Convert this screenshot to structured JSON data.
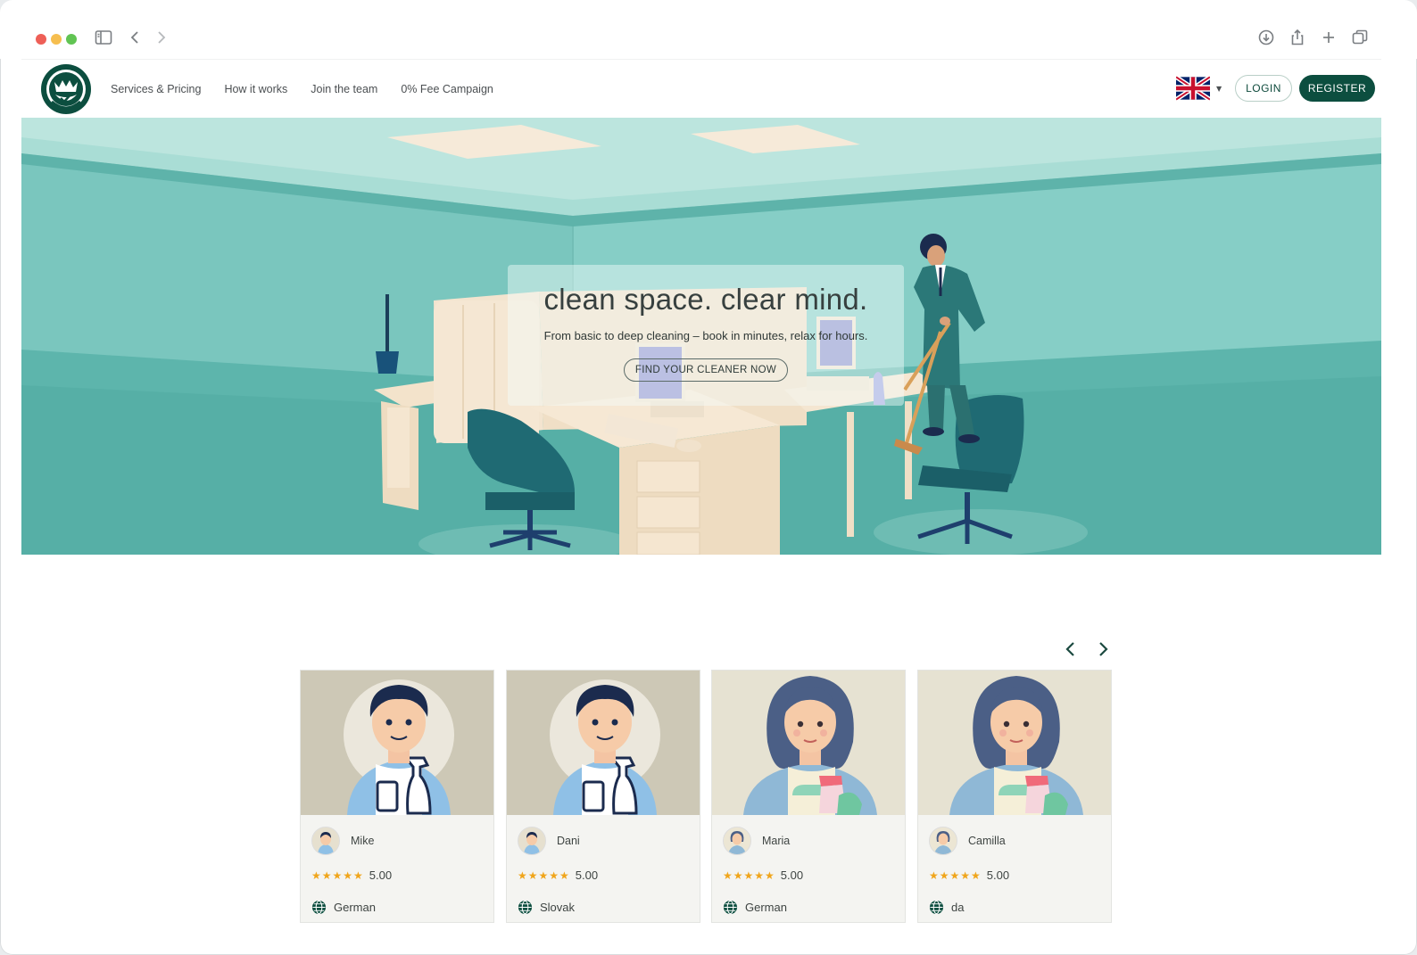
{
  "browser": {
    "icons": [
      "sidebar-icon",
      "back-icon",
      "forward-icon",
      "download-icon",
      "share-icon",
      "new-tab-icon",
      "tabs-overview-icon"
    ]
  },
  "header": {
    "nav": [
      {
        "label": "Services & Pricing"
      },
      {
        "label": "How it works"
      },
      {
        "label": "Join the team"
      },
      {
        "label": "0% Fee Campaign"
      }
    ],
    "language_flag": "uk-flag-icon",
    "login_label": "LOGIN",
    "register_label": "REGISTER"
  },
  "hero": {
    "title": "clean space. clear mind.",
    "subtitle": "From basic to deep cleaning – book in minutes, relax for hours.",
    "cta_label": "FIND YOUR CLEANER NOW"
  },
  "carousel": {
    "cleaners": [
      {
        "name": "Mike",
        "stars": "★★★★★",
        "rating": "5.00",
        "language": "German",
        "gender": "male"
      },
      {
        "name": "Dani",
        "stars": "★★★★★",
        "rating": "5.00",
        "language": "Slovak",
        "gender": "male"
      },
      {
        "name": "Maria",
        "stars": "★★★★★",
        "rating": "5.00",
        "language": "German",
        "gender": "female"
      },
      {
        "name": "Camilla",
        "stars": "★★★★★",
        "rating": "5.00",
        "language": "da",
        "gender": "female"
      }
    ]
  },
  "colors": {
    "brand": "#0c4e3f",
    "hero_bg": "#7dc8c0",
    "star": "#f0a51b"
  }
}
